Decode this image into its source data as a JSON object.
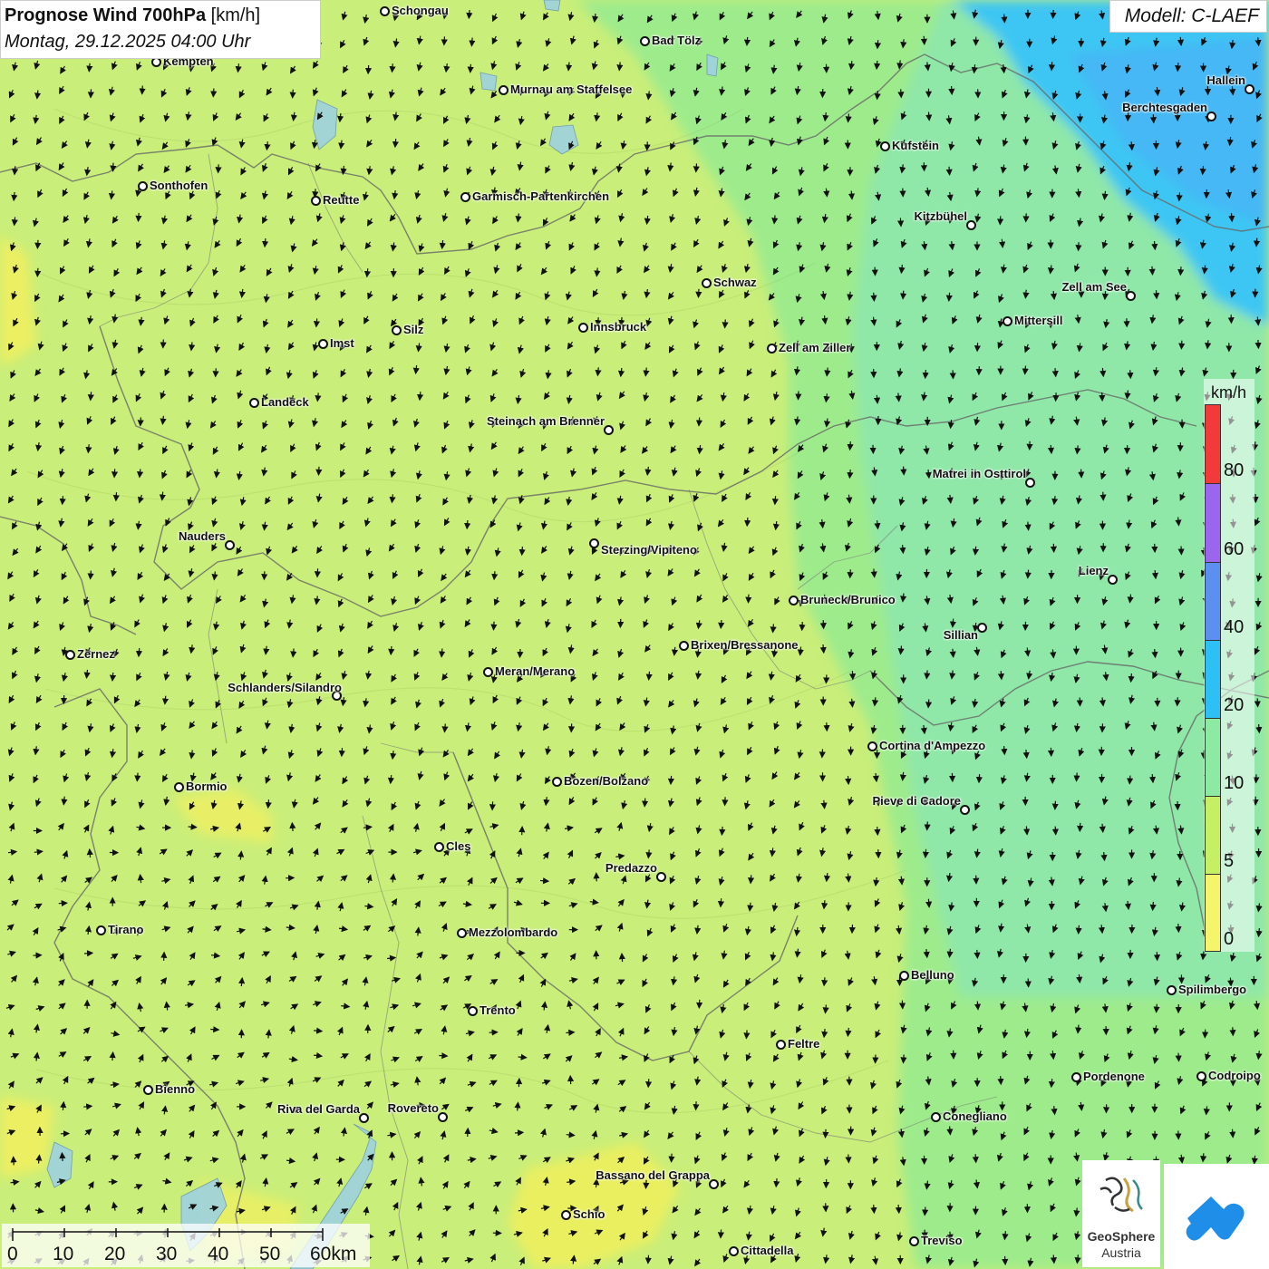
{
  "header": {
    "title_bold": "Prognose Wind 700hPa",
    "title_unit": "[km/h]",
    "datetime": "Montag, 29.12.2025 04:00 Uhr"
  },
  "model": "Modell: C-LAEF",
  "legend": {
    "unit": "km/h",
    "labels": [
      "80",
      "60",
      "40",
      "20",
      "10",
      "5",
      "0"
    ],
    "colors": [
      "#f23a3a",
      "#9a66ee",
      "#5b8ff0",
      "#2cc0f5",
      "#8ceaa2",
      "#c6f063",
      "#f5f56c"
    ]
  },
  "scalebar": {
    "labels": [
      "0",
      "10",
      "20",
      "30",
      "40",
      "50",
      "60km"
    ]
  },
  "logo": {
    "name": "GeoSphere",
    "sub": "Austria"
  },
  "map_colors": {
    "light_green": "#c8ee78",
    "green": "#9eea86",
    "aqua": "#8ee6a8",
    "cyan_blue": "#3cc8f2",
    "yellow": "#eaf062"
  },
  "cities": [
    {
      "name": "Schongau"
    },
    {
      "name": "Bad Tölz"
    },
    {
      "name": "Kempten"
    },
    {
      "name": "Murnau am Staffelsee"
    },
    {
      "name": "Hallein"
    },
    {
      "name": "Berchtesgaden"
    },
    {
      "name": "Kufstein"
    },
    {
      "name": "Sonthofen"
    },
    {
      "name": "Reutte"
    },
    {
      "name": "Garmisch-Partenkirchen"
    },
    {
      "name": "Kitzbühel"
    },
    {
      "name": "Schwaz"
    },
    {
      "name": "Zell am See"
    },
    {
      "name": "Innsbruck"
    },
    {
      "name": "Mittersill"
    },
    {
      "name": "Silz"
    },
    {
      "name": "Imst"
    },
    {
      "name": "Zell am Ziller"
    },
    {
      "name": "Landeck"
    },
    {
      "name": "Steinach am Brenner"
    },
    {
      "name": "Matrei in Osttirol"
    },
    {
      "name": "Nauders"
    },
    {
      "name": "Sterzing/Vipiteno"
    },
    {
      "name": "Lienz"
    },
    {
      "name": "Bruneck/Brunico"
    },
    {
      "name": "Sillian"
    },
    {
      "name": "Brixen/Bressanone"
    },
    {
      "name": "Zernez"
    },
    {
      "name": "Meran/Merano"
    },
    {
      "name": "Schlanders/Silandro"
    },
    {
      "name": "Cortina d'Ampezzo"
    },
    {
      "name": "Bozen/Bolzano"
    },
    {
      "name": "Bormio"
    },
    {
      "name": "Pieve di Cadore"
    },
    {
      "name": "Cles"
    },
    {
      "name": "Predazzo"
    },
    {
      "name": "Tirano"
    },
    {
      "name": "Mezzolombardo"
    },
    {
      "name": "Belluno"
    },
    {
      "name": "Spilimbergo"
    },
    {
      "name": "Trento"
    },
    {
      "name": "Feltre"
    },
    {
      "name": "Bienno"
    },
    {
      "name": "Pordenone"
    },
    {
      "name": "Codroipo"
    },
    {
      "name": "Riva del Garda"
    },
    {
      "name": "Rovereto"
    },
    {
      "name": "Conegliano"
    },
    {
      "name": "Bassano del Grappa"
    },
    {
      "name": "Schio"
    },
    {
      "name": "Treviso"
    },
    {
      "name": "Cittadella"
    }
  ]
}
